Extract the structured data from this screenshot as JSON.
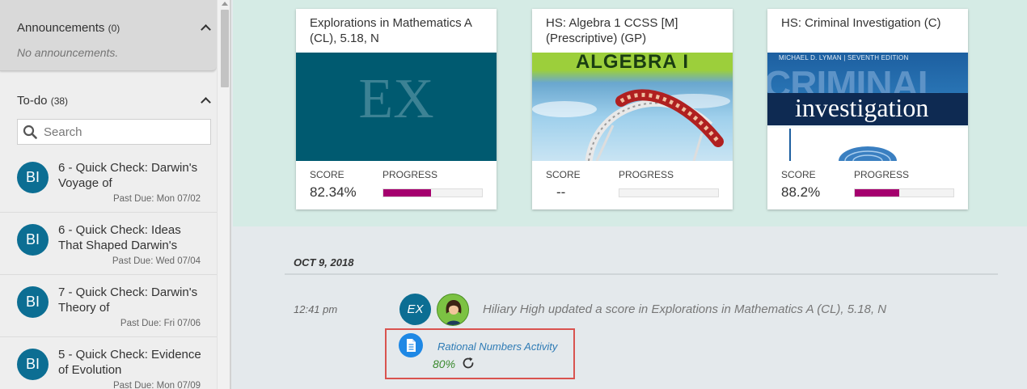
{
  "sidebar": {
    "announcements": {
      "title": "Announcements",
      "count": "(0)",
      "empty_text": "No announcements."
    },
    "todo": {
      "title": "To-do",
      "count": "(38)",
      "search_placeholder": "Search",
      "items": [
        {
          "avatar": "BI",
          "title": "6 - Quick Check: Darwin's Voyage of",
          "due": "Past Due: Mon 07/02"
        },
        {
          "avatar": "BI",
          "title": "6 - Quick Check: Ideas That Shaped Darwin's",
          "due": "Past Due: Wed 07/04"
        },
        {
          "avatar": "BI",
          "title": "7 - Quick Check: Darwin's Theory of",
          "due": "Past Due: Fri 07/06"
        },
        {
          "avatar": "BI",
          "title": "5 - Quick Check: Evidence of Evolution",
          "due": "Past Due: Mon 07/09"
        }
      ]
    }
  },
  "courses": [
    {
      "title": "Explorations in Mathematics A (CL), 5.18, N",
      "image_text": "EX",
      "score_label": "SCORE",
      "score": "82.34%",
      "progress_label": "PROGRESS",
      "progress": 0.48
    },
    {
      "title": "HS: Algebra 1 CCSS [M] (Prescriptive) (GP)",
      "image_text": "ALGEBRA I",
      "score_label": "SCORE",
      "score": "--",
      "progress_label": "PROGRESS",
      "progress": 0
    },
    {
      "title": "HS: Criminal Investigation (C)",
      "image_text": "investigation",
      "image_top_text": "MICHAEL D. LYMAN | SEVENTH EDITION",
      "image_big_text": "CRIMINAL",
      "score_label": "SCORE",
      "score": "88.2%",
      "progress_label": "PROGRESS",
      "progress": 0.45
    }
  ],
  "activity": {
    "date": "OCT 9, 2018",
    "time": "12:41 pm",
    "course_badge": "EX",
    "text": "Hiliary High updated a score in Explorations in Mathematics A (CL), 5.18, N",
    "assignment": "Rational Numbers Activity",
    "assignment_score": "80%"
  },
  "colors": {
    "accent": "#0c6e93",
    "progress": "#a5006e",
    "highlight": "#d9534f",
    "score_green": "#3a8a2e",
    "link": "#2e7bb5"
  }
}
